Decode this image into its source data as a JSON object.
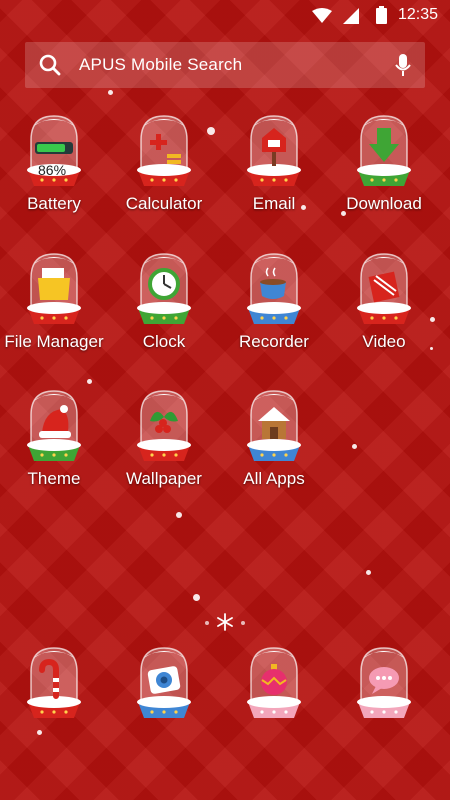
{
  "status_bar": {
    "time": "12:35",
    "icons": [
      "wifi-icon",
      "signal-icon",
      "battery-icon"
    ]
  },
  "search": {
    "placeholder": "APUS Mobile Search",
    "icons": [
      "search-icon",
      "mic-icon"
    ]
  },
  "apps": [
    {
      "label": "Battery",
      "icon": "battery-globe-icon",
      "badge": "86%"
    },
    {
      "label": "Calculator",
      "icon": "calculator-globe-icon"
    },
    {
      "label": "Email",
      "icon": "mailbox-globe-icon"
    },
    {
      "label": "Download",
      "icon": "download-globe-icon"
    },
    {
      "label": "File Manager",
      "icon": "folder-globe-icon"
    },
    {
      "label": "Clock",
      "icon": "clock-globe-icon"
    },
    {
      "label": "Recorder",
      "icon": "cup-globe-icon"
    },
    {
      "label": "Video",
      "icon": "gift-globe-icon"
    },
    {
      "label": "Theme",
      "icon": "santa-hat-globe-icon"
    },
    {
      "label": "Wallpaper",
      "icon": "holly-globe-icon"
    },
    {
      "label": "All Apps",
      "icon": "house-globe-icon"
    }
  ],
  "dock": [
    {
      "icon": "candy-cane-globe-icon"
    },
    {
      "icon": "camera-globe-icon"
    },
    {
      "icon": "ornament-globe-icon"
    },
    {
      "icon": "chat-globe-icon"
    }
  ],
  "page_indicator": {
    "icon": "snowflake-icon"
  },
  "colors": {
    "background": "#b5120f",
    "base_red": "#d7241d",
    "base_green": "#3fa535",
    "base_blue": "#3f86d4",
    "base_pink": "#f3a6bb"
  }
}
